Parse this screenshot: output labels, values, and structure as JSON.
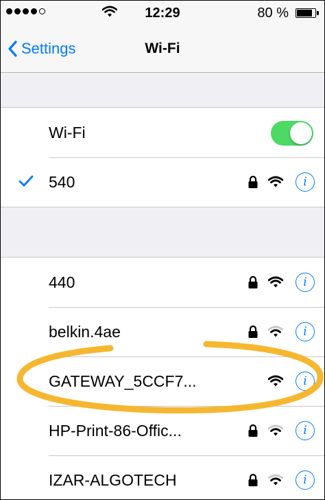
{
  "status_bar": {
    "signal_dots": [
      true,
      true,
      true,
      true,
      false
    ],
    "time": "12:29",
    "battery_pct": "80 %",
    "battery_level": 0.8
  },
  "nav": {
    "back_label": "Settings",
    "title": "Wi-Fi"
  },
  "wifi_toggle": {
    "label": "Wi-Fi",
    "on": true
  },
  "connected": {
    "name": "540",
    "locked": true,
    "strength": 3
  },
  "networks": [
    {
      "name": "440",
      "locked": true,
      "strength": 3
    },
    {
      "name": "belkin.4ae",
      "locked": true,
      "strength": 2
    },
    {
      "name": "GATEWAY_5CCF7...",
      "locked": false,
      "strength": 3
    },
    {
      "name": "HP-Print-86-Offic...",
      "locked": true,
      "strength": 2
    },
    {
      "name": "IZAR-ALGOTECH",
      "locked": true,
      "strength": 2
    }
  ],
  "info_symbol": "i",
  "colors": {
    "accent": "#007aff",
    "toggle_on": "#4cd964",
    "highlight_circle": "#f5b325"
  }
}
